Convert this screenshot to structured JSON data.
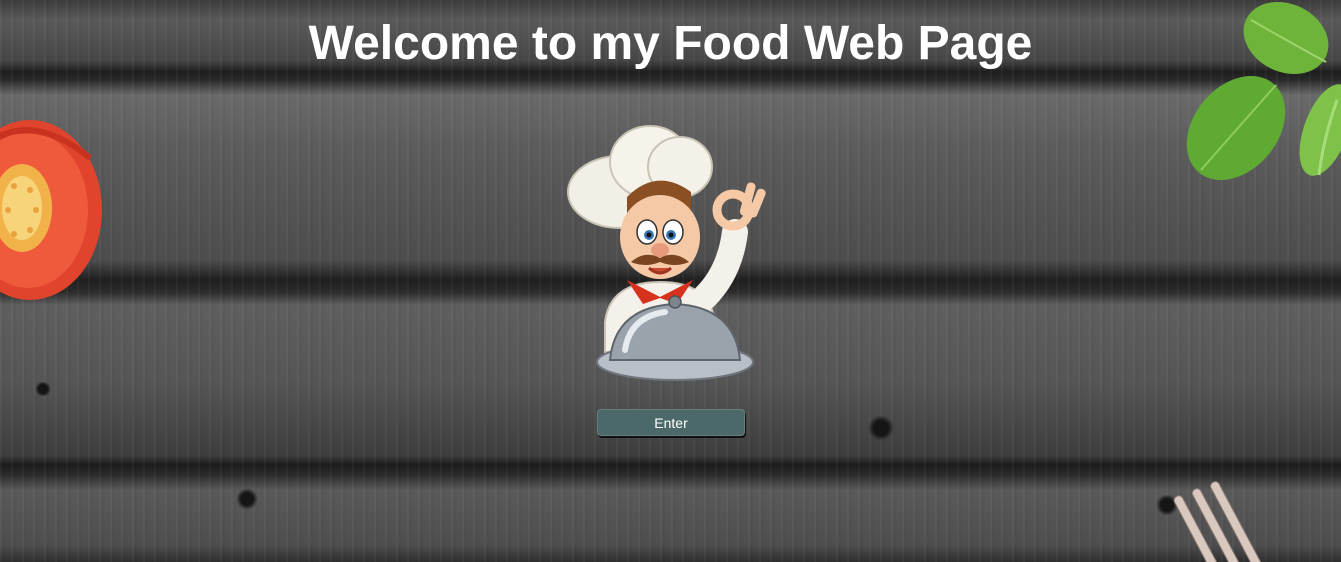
{
  "page": {
    "title": "Welcome to my Food Web Page"
  },
  "actions": {
    "enter_label": "Enter"
  },
  "colors": {
    "title_text": "#ffffff",
    "button_bg": "#4c6969",
    "button_text": "#ffffff",
    "wood": "#4a4a4a"
  },
  "icons": [
    "tomato-slice-icon",
    "basil-leaves-icon",
    "chef-mascot-icon",
    "fork-icon"
  ]
}
